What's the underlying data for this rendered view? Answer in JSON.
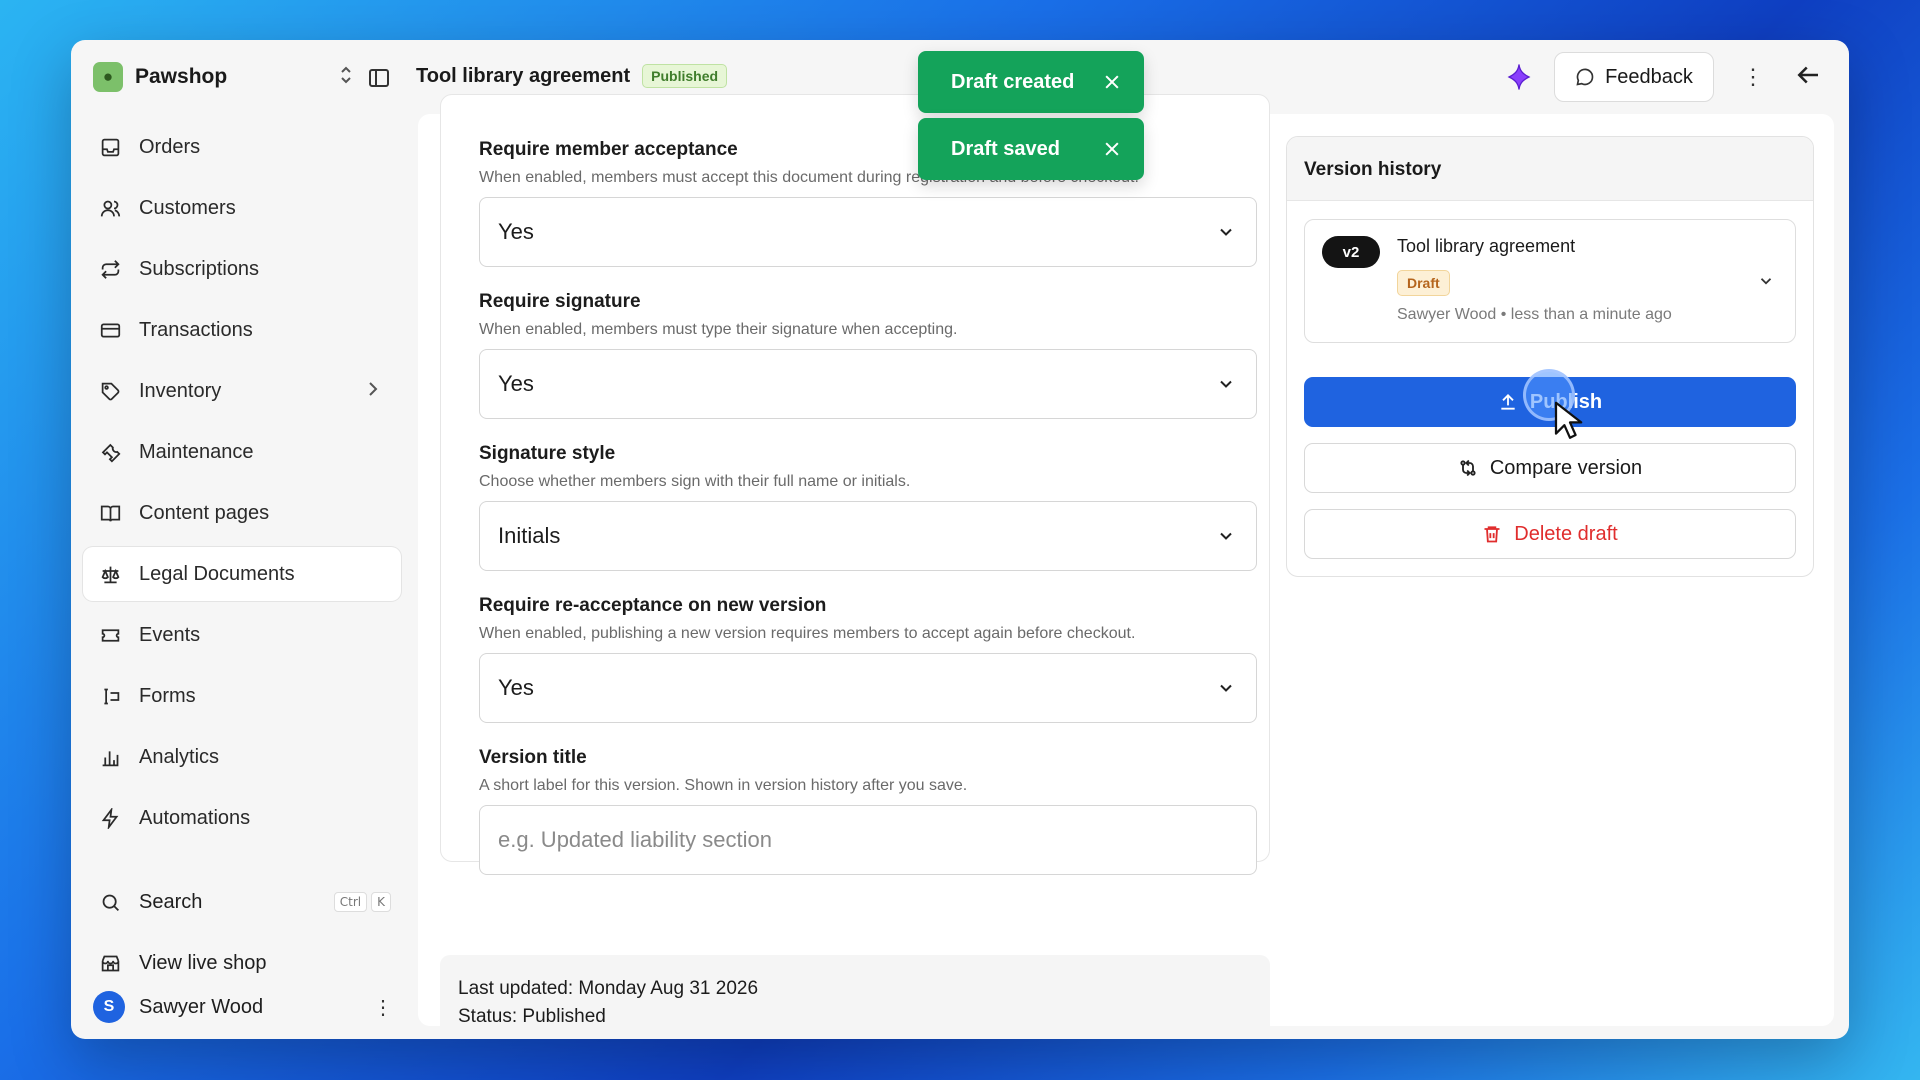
{
  "app": {
    "name": "Pawshop"
  },
  "header": {
    "title": "Tool library agreement",
    "status_badge": "Published",
    "feedback_label": "Feedback"
  },
  "sidebar": {
    "items": [
      {
        "label": "Orders",
        "icon": "inbox-icon"
      },
      {
        "label": "Customers",
        "icon": "users-icon"
      },
      {
        "label": "Subscriptions",
        "icon": "repeat-icon"
      },
      {
        "label": "Transactions",
        "icon": "credit-card-icon"
      },
      {
        "label": "Inventory",
        "icon": "tag-icon"
      },
      {
        "label": "Maintenance",
        "icon": "wrench-icon"
      },
      {
        "label": "Content pages",
        "icon": "book-icon"
      },
      {
        "label": "Legal Documents",
        "icon": "scale-icon"
      },
      {
        "label": "Events",
        "icon": "ticket-icon"
      },
      {
        "label": "Forms",
        "icon": "form-icon"
      },
      {
        "label": "Analytics",
        "icon": "bar-chart-icon"
      },
      {
        "label": "Automations",
        "icon": "bolt-icon"
      }
    ],
    "active": "Legal Documents",
    "search_label": "Search",
    "search_shortcut": [
      "Ctrl",
      "K"
    ],
    "view_shop_label": "View live shop",
    "user_name": "Sawyer Wood",
    "user_initial": "S"
  },
  "form": {
    "fields": [
      {
        "label": "Require member acceptance",
        "help": "When enabled, members must accept this document during registration and before checkout.",
        "value": "Yes"
      },
      {
        "label": "Require signature",
        "help": "When enabled, members must type their signature when accepting.",
        "value": "Yes"
      },
      {
        "label": "Signature style",
        "help": "Choose whether members sign with their full name or initials.",
        "value": "Initials"
      },
      {
        "label": "Require re-acceptance on new version",
        "help": "When enabled, publishing a new version requires members to accept again before checkout.",
        "value": "Yes"
      }
    ],
    "version_title": {
      "label": "Version title",
      "help": "A short label for this version. Shown in version history after you save.",
      "placeholder": "e.g. Updated liability section",
      "value": ""
    }
  },
  "meta": {
    "last_updated": "Last updated: Monday Aug 31 2026",
    "status": "Status: Published"
  },
  "version_history": {
    "title": "Version history",
    "version": {
      "tag": "v2",
      "name": "Tool library agreement",
      "status": "Draft",
      "meta": "Sawyer Wood • less than a minute ago"
    },
    "publish_label": "Publish",
    "compare_label": "Compare version",
    "delete_label": "Delete draft"
  },
  "toasts": [
    "Draft created",
    "Draft saved"
  ],
  "colors": {
    "primary": "#1f63e0",
    "success": "#14a35a",
    "danger": "#e02d2d",
    "published_badge": "#3f7d2b",
    "draft_badge": "#b5651d"
  }
}
